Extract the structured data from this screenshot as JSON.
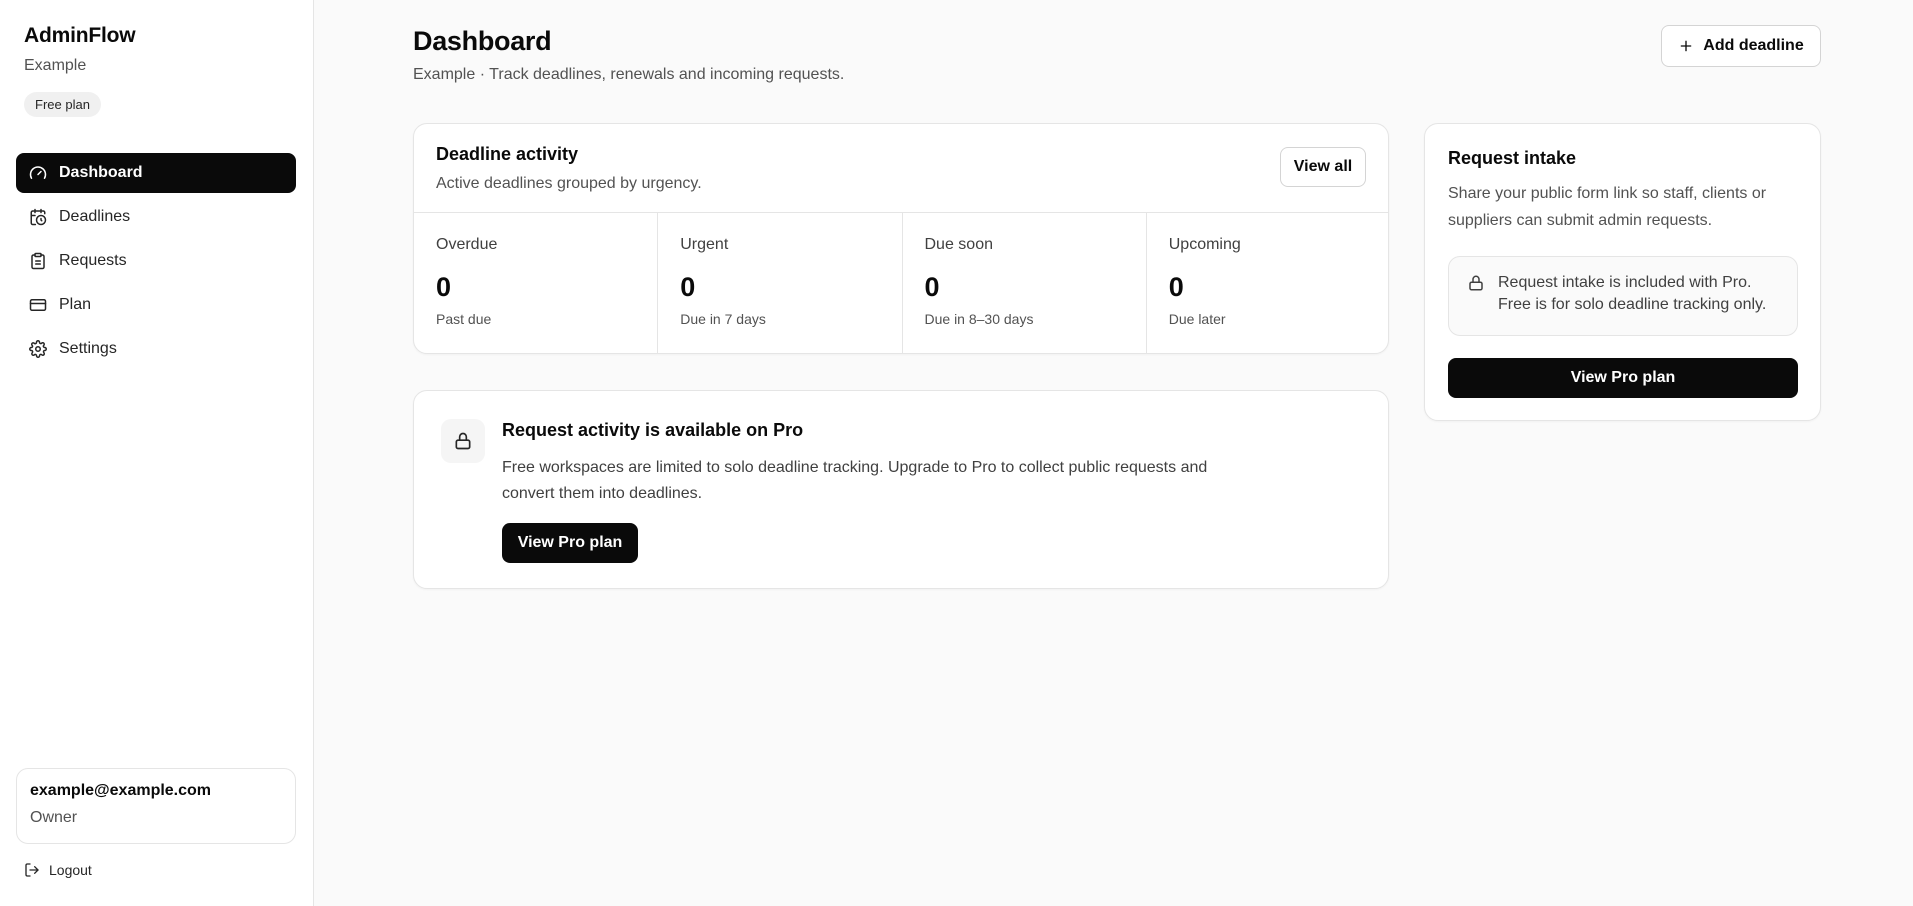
{
  "app": {
    "name": "AdminFlow",
    "workspace": "Example",
    "plan_badge": "Free plan"
  },
  "sidebar": {
    "items": [
      {
        "label": "Dashboard",
        "icon": "gauge-icon",
        "active": true
      },
      {
        "label": "Deadlines",
        "icon": "calendar-clock-icon",
        "active": false
      },
      {
        "label": "Requests",
        "icon": "clipboard-icon",
        "active": false
      },
      {
        "label": "Plan",
        "icon": "credit-card-icon",
        "active": false
      },
      {
        "label": "Settings",
        "icon": "gear-icon",
        "active": false
      }
    ],
    "account": {
      "email": "example@example.com",
      "role": "Owner"
    },
    "logout_label": "Logout"
  },
  "header": {
    "title": "Dashboard",
    "subtitle": "Example · Track deadlines, renewals and incoming requests.",
    "add_button_label": "Add deadline"
  },
  "deadline_activity": {
    "title": "Deadline activity",
    "subtitle": "Active deadlines grouped by urgency.",
    "view_all_label": "View all",
    "stats": [
      {
        "label": "Overdue",
        "value": "0",
        "note": "Past due"
      },
      {
        "label": "Urgent",
        "value": "0",
        "note": "Due in 7 days"
      },
      {
        "label": "Due soon",
        "value": "0",
        "note": "Due in 8–30 days"
      },
      {
        "label": "Upcoming",
        "value": "0",
        "note": "Due later"
      }
    ]
  },
  "request_activity": {
    "title": "Request activity is available on Pro",
    "text": "Free workspaces are limited to solo deadline tracking. Upgrade to Pro to collect public requests and convert them into deadlines.",
    "button_label": "View Pro plan"
  },
  "request_intake": {
    "title": "Request intake",
    "text": "Share your public form link so staff, clients or suppliers can submit admin requests.",
    "note": "Request intake is included with Pro. Free is for solo deadline tracking only.",
    "button_label": "View Pro plan"
  },
  "colors": {
    "accent": "#0a0a0a",
    "background": "#fafafa",
    "border": "#e5e5e5",
    "muted_text": "#525252"
  }
}
